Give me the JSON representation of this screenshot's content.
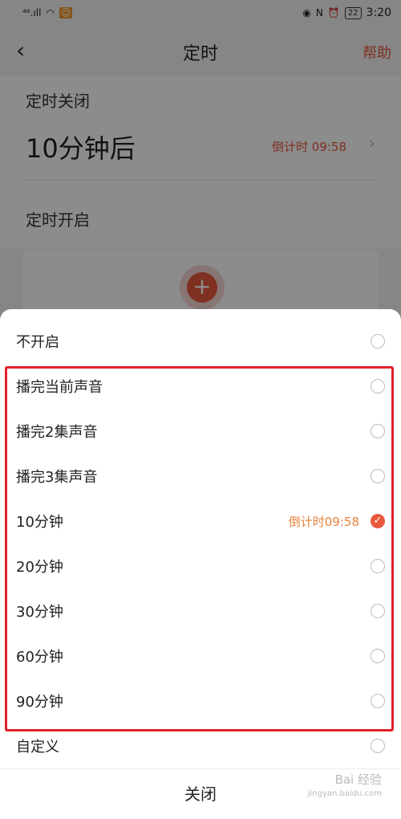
{
  "status_bar": {
    "signal_text": "⁴⁶.ıll",
    "time": "3:20",
    "battery": "22"
  },
  "nav": {
    "title": "定时",
    "help": "帮助"
  },
  "timer_off": {
    "section_title": "定时关闭",
    "value": "10分钟后",
    "countdown": "倒计时 09:58"
  },
  "timer_on": {
    "section_title": "定时开启"
  },
  "sheet": {
    "options": [
      {
        "label": "不开启",
        "right": ""
      },
      {
        "label": "播完当前声音",
        "right": ""
      },
      {
        "label": "播完2集声音",
        "right": ""
      },
      {
        "label": "播完3集声音",
        "right": ""
      },
      {
        "label": "10分钟",
        "right": "倒计时09:58"
      },
      {
        "label": "20分钟",
        "right": ""
      },
      {
        "label": "30分钟",
        "right": ""
      },
      {
        "label": "60分钟",
        "right": ""
      },
      {
        "label": "90分钟",
        "right": ""
      },
      {
        "label": "自定义",
        "right": ""
      }
    ],
    "selected_index": 4,
    "close_label": "关闭"
  },
  "watermark": {
    "line1": "Bai 经验",
    "line2": "jingyan.baidu.com"
  },
  "colors": {
    "accent": "#e8583c",
    "countdown_orange": "#e8823c",
    "highlight_red": "#e0202a"
  }
}
